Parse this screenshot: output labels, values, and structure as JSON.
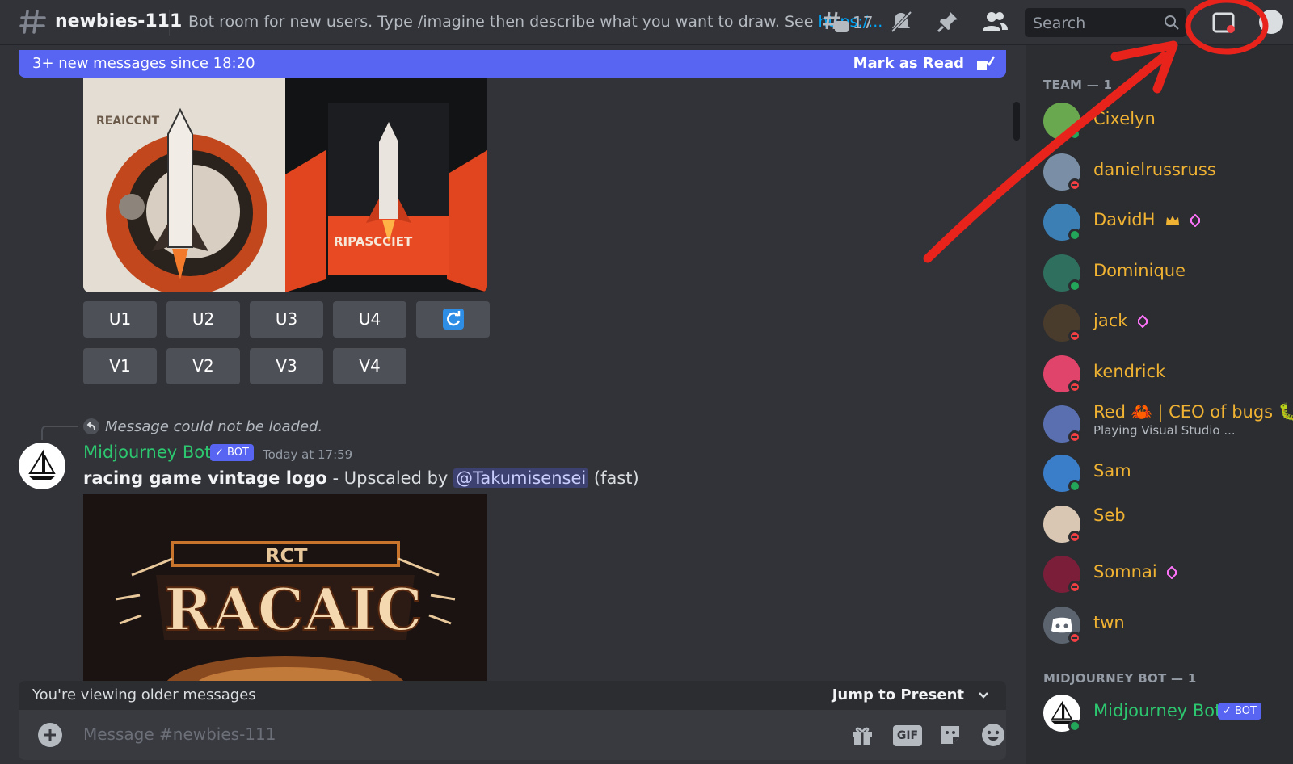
{
  "header": {
    "channel_name": "newbies-111",
    "topic_text": "Bot room for new users. Type /imagine then describe what you want to draw. See ",
    "topic_link": "https:/...",
    "threads_count": "17",
    "search_placeholder": "Search"
  },
  "banner": {
    "text": "3+ new messages since 18:20",
    "action": "Mark as Read"
  },
  "grid_buttons": {
    "upscale": [
      "U1",
      "U2",
      "U3",
      "U4"
    ],
    "variation": [
      "V1",
      "V2",
      "V3",
      "V4"
    ]
  },
  "image1_texts": {
    "left_title": "REAICCNT",
    "right_title": "RIPASCCIET"
  },
  "message": {
    "reply_text": "Message could not be loaded.",
    "author": "Midjourney Bot",
    "bot_tag": "✓ BOT",
    "timestamp": "Today at 17:59",
    "prompt": "racing game vintage logo",
    "middle": " - Upscaled by ",
    "mention": "@Takumisensei",
    "suffix": " (fast)"
  },
  "image2_texts": {
    "top": "RCT",
    "main": "RACAIC"
  },
  "older_bar": {
    "text": "You're viewing older messages",
    "action": "Jump to Present"
  },
  "composer": {
    "placeholder": "Message #newbies-111",
    "gif_label": "GIF"
  },
  "members": {
    "section_team": "TEAM — 1",
    "section_bot": "MIDJOURNEY BOT — 1",
    "team": [
      {
        "name": "Cixelyn",
        "status": "online",
        "avatar_color": "#6aa84f"
      },
      {
        "name": "danielrussruss",
        "status": "dnd",
        "avatar_color": "#7a8fa6"
      },
      {
        "name": "DavidH",
        "status": "online",
        "avatar_color": "#3b7fb5"
      },
      {
        "name": "Dominique",
        "status": "online",
        "avatar_color": "#2f6f5e"
      },
      {
        "name": "jack",
        "status": "dnd",
        "avatar_color": "#4a3c2c"
      },
      {
        "name": "kendrick",
        "status": "dnd",
        "avatar_color": "#e0446a"
      },
      {
        "name": "Red 🦀 | CEO of bugs 🐛",
        "status": "dnd",
        "avatar_color": "#5a6fb0",
        "activity": "Playing Visual Studio ..."
      },
      {
        "name": "Sam",
        "status": "online",
        "avatar_color": "#3a7dc9"
      },
      {
        "name": "Seb",
        "status": "dnd",
        "avatar_color": "#d9c7b3"
      },
      {
        "name": "Somnai",
        "status": "dnd",
        "avatar_color": "#7a1e3a"
      },
      {
        "name": "twn",
        "status": "dnd",
        "avatar_color": "#5c6470"
      }
    ],
    "bot": {
      "name": "Midjourney Bot",
      "tag": "✓ BOT",
      "status": "online"
    }
  },
  "colors": {
    "accent": "#5865f2",
    "member_orange": "#f0b232",
    "bot_green": "#2dc770",
    "annotation_red": "#e8231c"
  }
}
